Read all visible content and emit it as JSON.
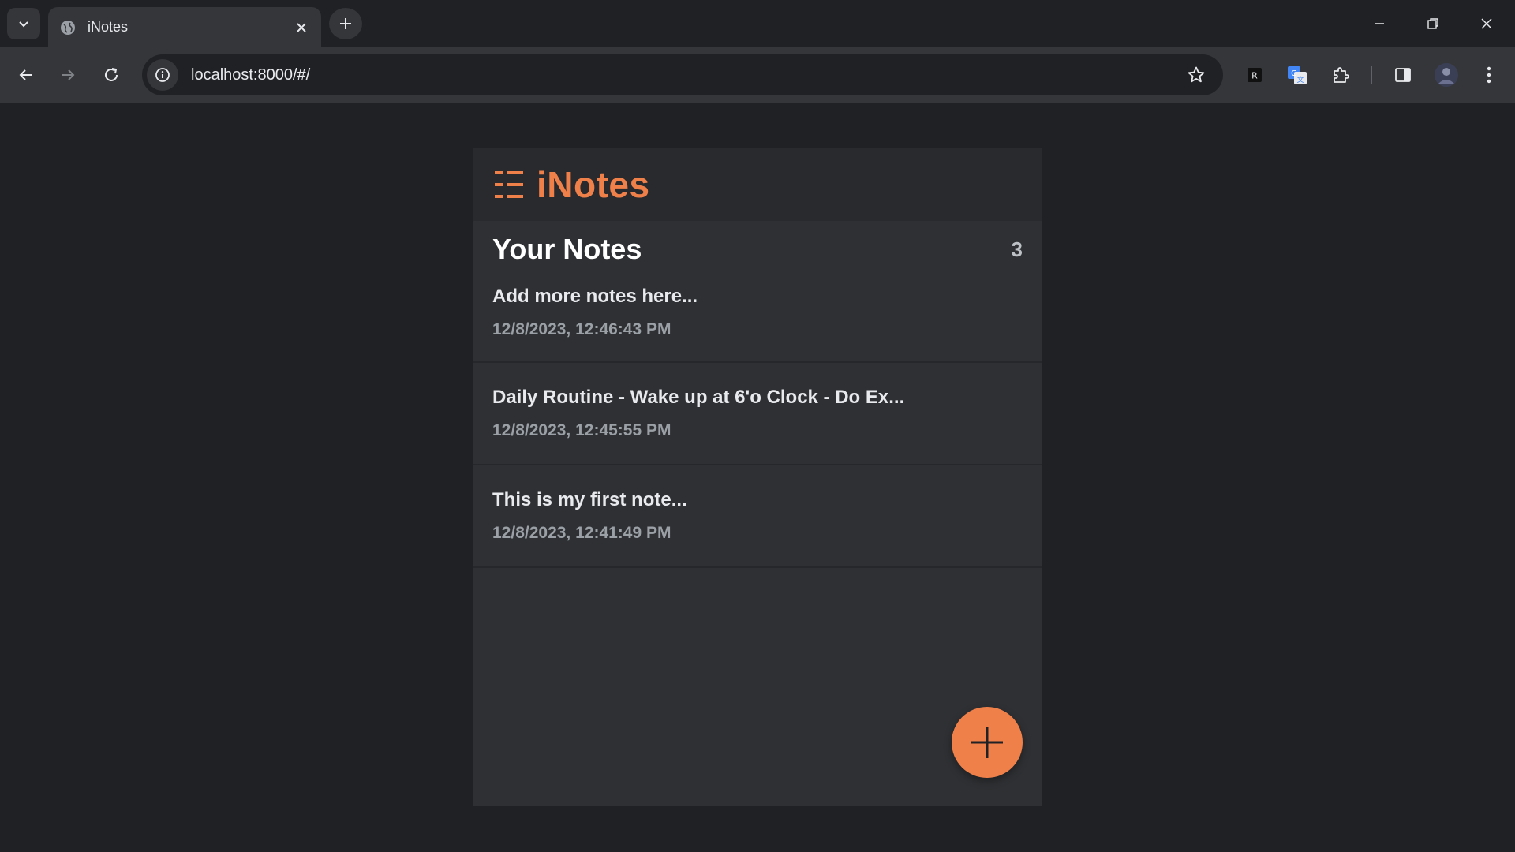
{
  "browser": {
    "tab_title": "iNotes",
    "url": "localhost:8000/#/"
  },
  "app": {
    "title": "iNotes",
    "accent_color": "#f0804a",
    "notes_heading": "Your Notes",
    "notes_count": "3",
    "notes": [
      {
        "title": "Add more notes here...",
        "date": "12/8/2023, 12:46:43 PM"
      },
      {
        "title": "Daily Routine - Wake up at 6'o Clock - Do Ex...",
        "date": "12/8/2023, 12:45:55 PM"
      },
      {
        "title": "This is my first note...",
        "date": "12/8/2023, 12:41:49 PM"
      }
    ],
    "fab_icon": "plus-icon"
  }
}
